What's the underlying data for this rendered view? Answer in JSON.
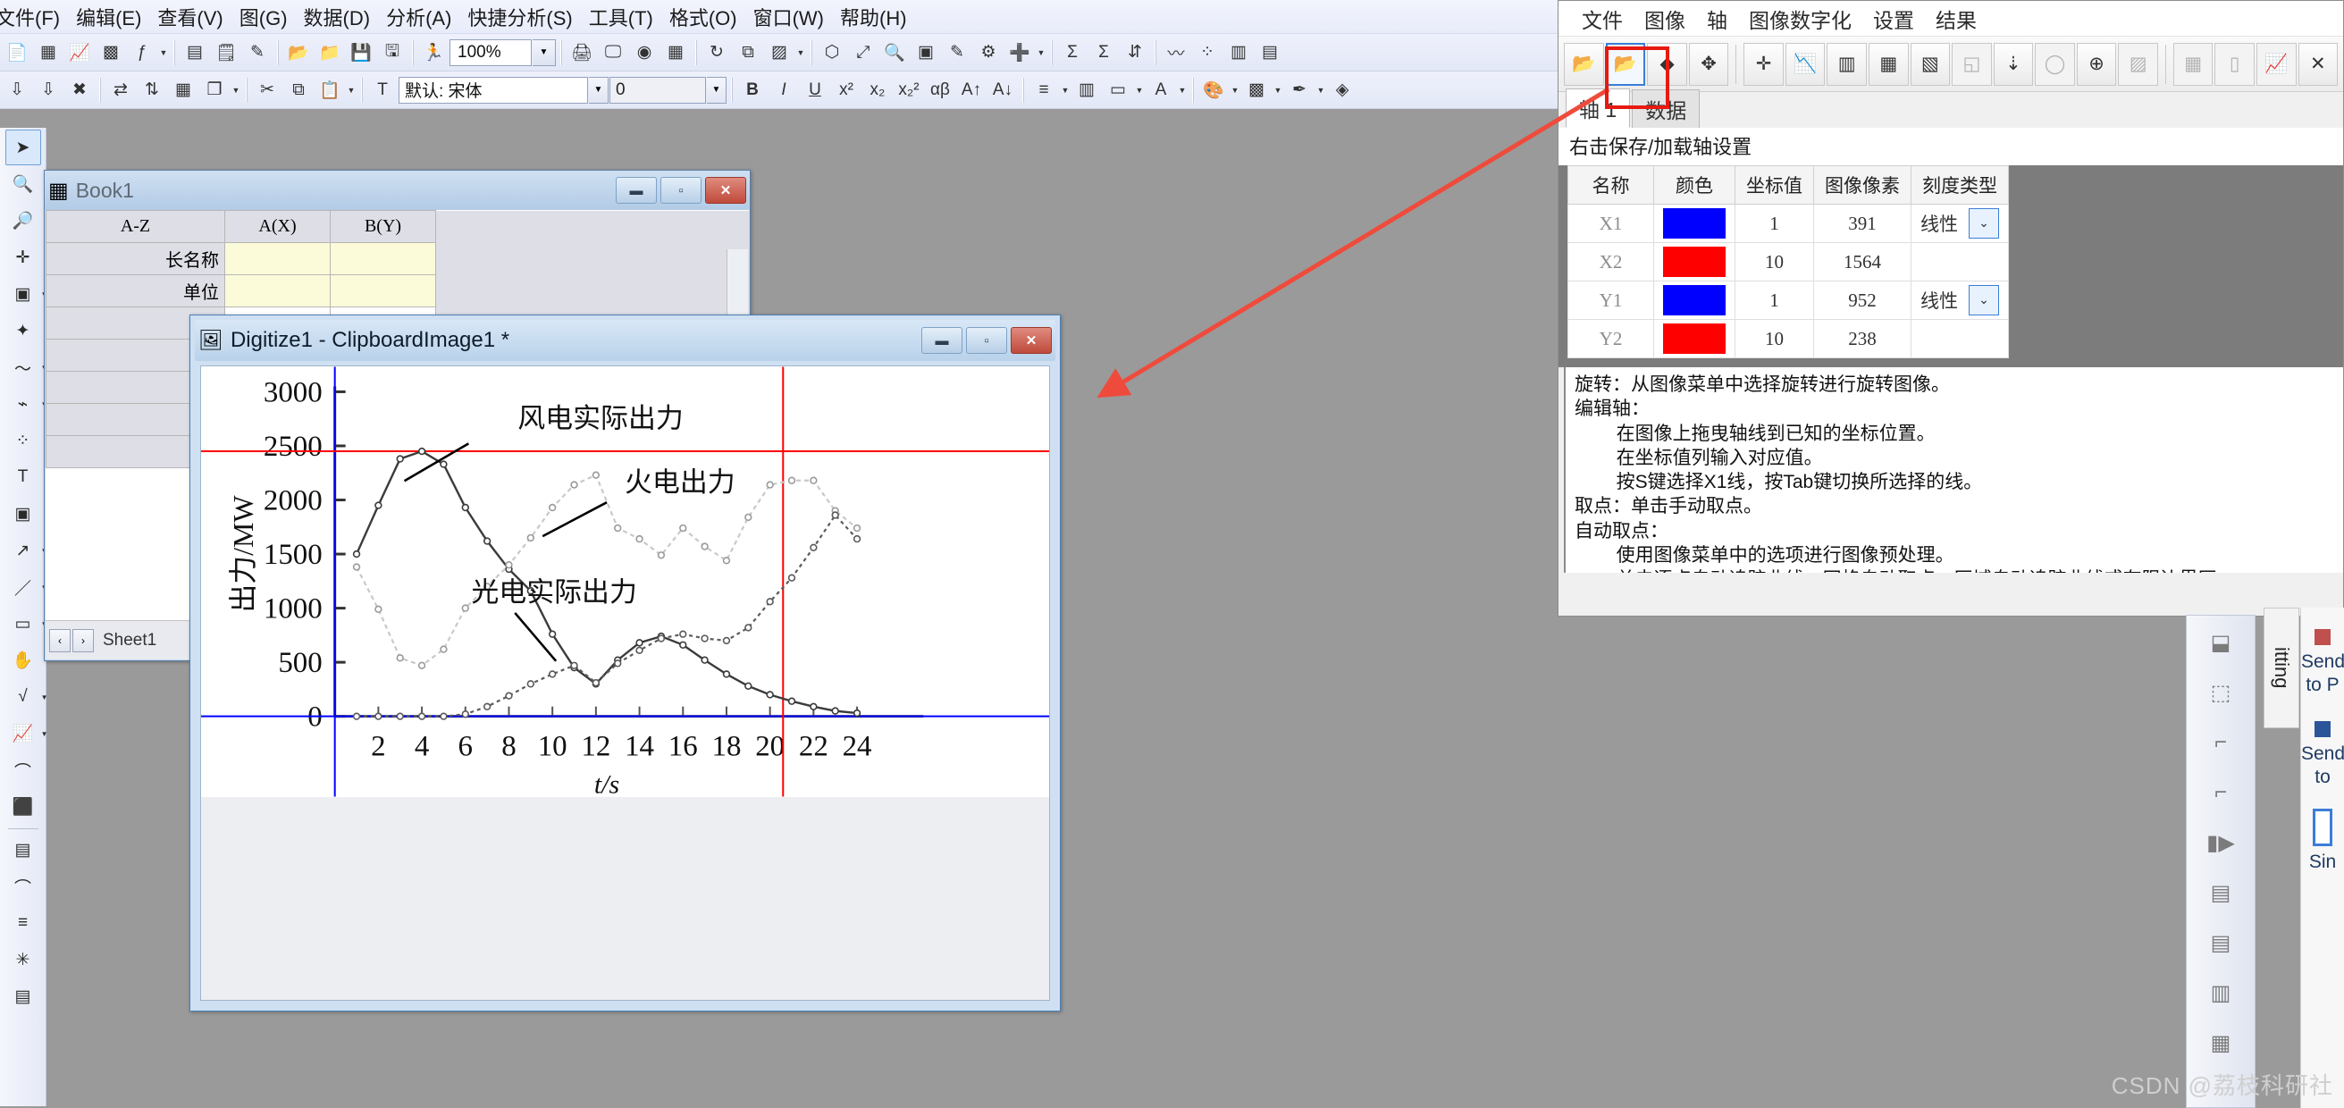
{
  "app": {
    "menu": [
      "文件(F)",
      "编辑(E)",
      "查看(V)",
      "图(G)",
      "数据(D)",
      "分析(A)",
      "快捷分析(S)",
      "工具(T)",
      "格式(O)",
      "窗口(W)",
      "帮助(H)"
    ],
    "toolbar_zoom": "100%",
    "font_name": "默认: 宋体",
    "font_size": "0"
  },
  "toolbar_icons": {
    "row1": [
      "new-project-icon",
      "new-workbook-icon",
      "new-graph-icon",
      "new-matrix-icon",
      "new-function-plot-icon",
      "new-layout-icon",
      "new-notes-icon",
      "new-excel-icon",
      "open-project-icon",
      "open-excel-icon",
      "save-project-icon",
      "save-template-icon",
      "run-script-icon",
      "print-icon",
      "print-preview-icon",
      "export-graph-icon",
      "import-data-icon",
      "rescale-icon",
      "new-layer-icon",
      "zoom-in-icon",
      "zoom-panel-icon",
      "refresh-icon",
      "duplicate-icon",
      "plot-setup-icon",
      "layer-contents-icon",
      "add-text-icon",
      "sum-icon",
      "statistics-icon",
      "sort-icon",
      "line-plot-icon",
      "scatter-icon",
      "column-plot-icon",
      "bar-plot-icon"
    ],
    "row2": [
      "sort-ascending-icon",
      "sort-descending-icon",
      "remove-duplicates-icon",
      "swap-columns-icon",
      "transpose-icon",
      "reduce-rows-icon",
      "stack-columns-icon",
      "cut-icon",
      "copy-icon",
      "paste-icon",
      "font-icon",
      "bold-icon",
      "italic-icon",
      "underline-icon",
      "superscript-icon",
      "subscript-icon",
      "super-sub-icon",
      "greek-icon",
      "increase-font-icon",
      "decrease-font-icon",
      "align-icon",
      "line-style-icon",
      "color-icon",
      "fill-color-icon",
      "pattern-icon",
      "line-color-icon"
    ]
  },
  "left_toolbar": [
    "pointer-icon",
    "zoom-in-icon",
    "zoom-out-icon",
    "data-reader-icon",
    "screen-reader-icon",
    "data-cursor-icon",
    "data-selector-icon",
    "regional-mask-icon",
    "scatter-tool-icon",
    "text-tool-icon",
    "annotation-icon",
    "arrow-tool-icon",
    "line-tool-icon",
    "rectangle-tool-icon",
    "pan-icon",
    "equation-icon",
    "graph-tool-icon",
    "curve-tool-icon",
    "3d-rotate-icon",
    "color-scale-icon",
    "arc-tool-icon",
    "legend-icon",
    "asterisk-icon",
    "table-icon"
  ],
  "book1": {
    "title": "Book1",
    "icon": "workbook-icon",
    "columns": [
      "A(X)",
      "B(Y)"
    ],
    "rows": [
      {
        "header": "长名称",
        "cells": [
          "",
          ""
        ],
        "style": "yellow"
      },
      {
        "header": "单位",
        "cells": [
          "",
          ""
        ],
        "style": "yellow"
      },
      {
        "header": "",
        "cells": [
          "",
          ""
        ],
        "style": "plain"
      },
      {
        "header": "",
        "cells": [
          "",
          ""
        ],
        "style": "plain"
      },
      {
        "header": "",
        "cells": [
          "",
          ""
        ],
        "style": "plain"
      },
      {
        "header": "",
        "cells": [
          "",
          ""
        ],
        "style": "plain"
      },
      {
        "header": "",
        "cells": [
          "",
          ""
        ],
        "style": "plain"
      }
    ],
    "sheet_tab": "Sheet1",
    "win_buttons": [
      "minimize",
      "maximize",
      "close"
    ]
  },
  "digitize_window": {
    "title": "Digitize1 - ClipboardImage1 *",
    "icon": "digitizer-icon",
    "win_buttons": [
      "minimize",
      "maximize",
      "close"
    ]
  },
  "chart_data": {
    "type": "line",
    "title": "",
    "xlabel": "t/s",
    "ylabel": "出力/MW",
    "xlim": [
      0,
      25
    ],
    "ylim": [
      0,
      3000
    ],
    "xticks": [
      2,
      4,
      6,
      8,
      10,
      12,
      14,
      16,
      18,
      20,
      22,
      24
    ],
    "yticks": [
      0,
      500,
      1000,
      1500,
      2000,
      2500,
      3000
    ],
    "grid": false,
    "annotations": [
      {
        "text": "风电实际出力",
        "series": "wind"
      },
      {
        "text": "火电出力",
        "series": "thermal"
      },
      {
        "text": "光电实际出力",
        "series": "solar"
      }
    ],
    "x": [
      1,
      2,
      3,
      4,
      5,
      6,
      7,
      8,
      9,
      10,
      11,
      12,
      13,
      14,
      15,
      16,
      17,
      18,
      19,
      20,
      21,
      22,
      23,
      24
    ],
    "series": [
      {
        "name": "风电实际出力",
        "values": [
          1500,
          1950,
          2380,
          2450,
          2330,
          1930,
          1620,
          1360,
          1160,
          760,
          450,
          300,
          520,
          680,
          740,
          660,
          520,
          390,
          280,
          200,
          140,
          90,
          50,
          30
        ]
      },
      {
        "name": "火电出力",
        "values": [
          1380,
          990,
          540,
          470,
          620,
          1000,
          1200,
          1400,
          1650,
          1930,
          2140,
          2230,
          1740,
          1640,
          1490,
          1740,
          1570,
          1440,
          1840,
          2140,
          2180,
          2180,
          1900,
          1740
        ]
      },
      {
        "name": "光电实际出力",
        "values": [
          0,
          0,
          0,
          0,
          0,
          20,
          90,
          190,
          300,
          390,
          470,
          310,
          490,
          610,
          720,
          760,
          720,
          700,
          820,
          1060,
          1280,
          1560,
          1860,
          1640
        ]
      }
    ]
  },
  "digitizer_panel": {
    "menu": [
      "文件",
      "图像",
      "轴",
      "图像数字化",
      "设置",
      "结果"
    ],
    "toolbar": [
      {
        "name": "open-image-icon",
        "state": "normal"
      },
      {
        "name": "open-clipboard-image-icon",
        "state": "active"
      },
      {
        "name": "image-thumbnail-icon",
        "state": "normal"
      },
      {
        "name": "move-image-icon",
        "state": "normal"
      },
      {
        "name": "set-axes-point-icon",
        "state": "normal"
      },
      {
        "name": "manual-pick-icon",
        "state": "normal"
      },
      {
        "name": "auto-trace-curve-icon",
        "state": "normal"
      },
      {
        "name": "grid-auto-pick-icon",
        "state": "normal"
      },
      {
        "name": "area-auto-trace-icon",
        "state": "normal"
      },
      {
        "name": "boundary-region-icon",
        "state": "disabled"
      },
      {
        "name": "cursor-list-icon",
        "state": "normal"
      },
      {
        "name": "lasso-icon",
        "state": "disabled"
      },
      {
        "name": "export-points-icon",
        "state": "normal"
      },
      {
        "name": "clear-grid-icon",
        "state": "disabled"
      },
      {
        "name": "add-to-worksheet-icon",
        "state": "disabled"
      },
      {
        "name": "send-to-column-icon",
        "state": "disabled"
      },
      {
        "name": "send-to-graph-icon",
        "state": "disabled"
      },
      {
        "name": "close-icon",
        "state": "normal"
      }
    ],
    "tabs": [
      {
        "label": "轴 1",
        "active": true
      },
      {
        "label": "数据",
        "active": false
      }
    ],
    "hint": "右击保存/加载轴设置",
    "axis_table": {
      "headers": [
        "名称",
        "颜色",
        "坐标值",
        "图像像素",
        "刻度类型"
      ],
      "rows": [
        {
          "name": "X1",
          "color": "#0000ff",
          "value": "1",
          "pixel": "391",
          "scale": "线性",
          "has_dropdown": true
        },
        {
          "name": "X2",
          "color": "#ff0000",
          "value": "10",
          "pixel": "1564",
          "scale": "",
          "has_dropdown": false
        },
        {
          "name": "Y1",
          "color": "#0000ff",
          "value": "1",
          "pixel": "952",
          "scale": "线性",
          "has_dropdown": true
        },
        {
          "name": "Y2",
          "color": "#ff0000",
          "value": "10",
          "pixel": "238",
          "scale": "",
          "has_dropdown": false
        }
      ]
    },
    "help_text": "旋转：从图像菜单中选择旋转进行旋转图像。\n编辑轴：\n        在图像上拖曳轴线到已知的坐标位置。\n        在坐标值列输入对应值。\n        按S键选择X1线，按Tab键切换所选择的线。\n取点：单击手动取点。\n自动取点：\n        使用图像菜单中的选项进行图像预处理。\n        单击逐点自动追踪曲线，网格自动取点，区域自动追踪曲线或有限边界区"
  },
  "right_edge": {
    "vertical_tab": "itting",
    "app_items": [
      "Send\nto P",
      "Send\nto",
      "Sin"
    ],
    "icons": [
      "frame-icon",
      "dashed-frame-icon",
      "axis-corner-icon",
      "axis-tick-icon",
      "expand-icon",
      "align-left-icon",
      "align-right-icon",
      "distribute-icon",
      "group-icon"
    ]
  },
  "watermark": "CSDN @荔枝科研社",
  "colors": {
    "accent_red": "#e8190f",
    "axis_blue": "#0000ff",
    "axis_red": "#ff0000",
    "titlebar": "#b3cbe6"
  }
}
